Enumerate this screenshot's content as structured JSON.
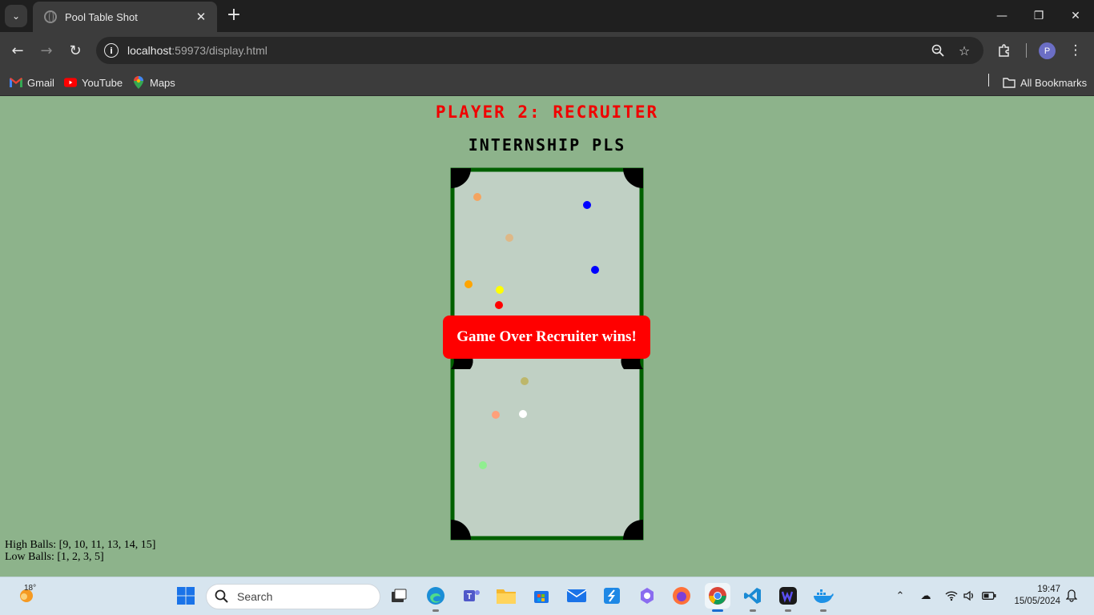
{
  "browser": {
    "tab_title": "Pool Table Shot",
    "url_host": "localhost",
    "url_rest": ":59973/display.html",
    "profile_initial": "P",
    "bookmarks": [
      {
        "label": "Gmail",
        "icon": "gmail-icon"
      },
      {
        "label": "YouTube",
        "icon": "youtube-icon"
      },
      {
        "label": "Maps",
        "icon": "maps-icon"
      }
    ],
    "all_bookmarks_label": "All Bookmarks"
  },
  "page": {
    "player_title": "PLAYER 2: RECRUITER",
    "subtitle": "INTERNSHIP PLS",
    "game_over_message": "Game Over Recruiter wins!",
    "high_balls_text": "High Balls: [9, 10, 11, 13, 14, 15]",
    "low_balls_text": "Low Balls: [1, 2, 3, 5]"
  },
  "pool_table": {
    "felt_color": "#c0d0c4",
    "rail_color": "#006000",
    "pocket_color": "#000000",
    "balls": [
      {
        "name": "ball-sandybrown",
        "color": "#f4a460"
      },
      {
        "name": "ball-blue-1",
        "color": "#0000ff"
      },
      {
        "name": "ball-burlywood",
        "color": "#deb887"
      },
      {
        "name": "ball-blue-2",
        "color": "#0000ff"
      },
      {
        "name": "ball-orange",
        "color": "#ffa500"
      },
      {
        "name": "ball-yellow",
        "color": "#ffff00"
      },
      {
        "name": "ball-red",
        "color": "#ff0000"
      },
      {
        "name": "ball-darkkhaki",
        "color": "#bdb76b"
      },
      {
        "name": "ball-lightsalmon",
        "color": "#ffa07a"
      },
      {
        "name": "cue-ball",
        "color": "#ffffff"
      },
      {
        "name": "ball-lightgreen",
        "color": "#90ee90"
      }
    ]
  },
  "taskbar": {
    "weather_temp": "18°",
    "search_placeholder": "Search",
    "time": "19:47",
    "date": "15/05/2024"
  }
}
